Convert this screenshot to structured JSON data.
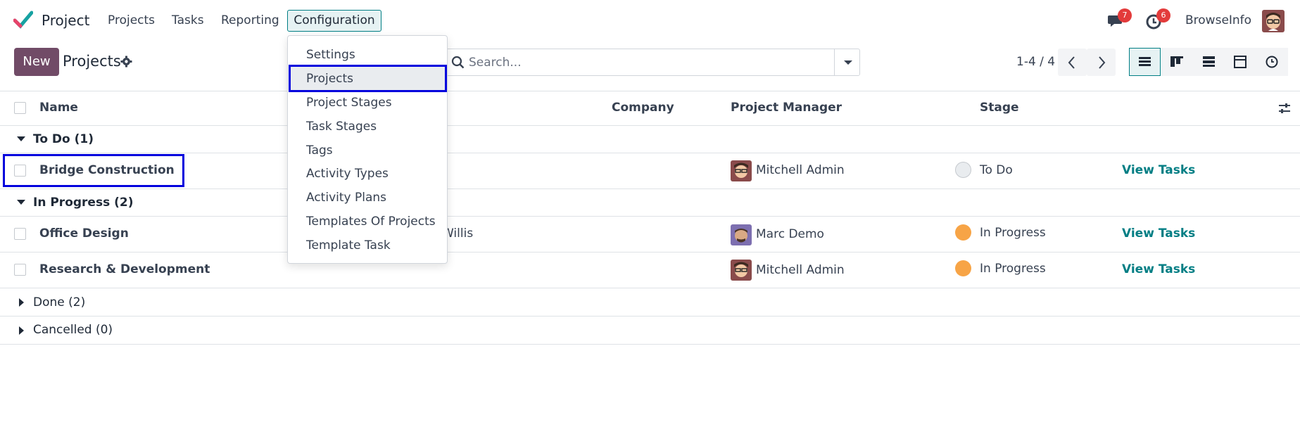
{
  "navbar": {
    "app_name": "Project",
    "menus": [
      "Projects",
      "Tasks",
      "Reporting",
      "Configuration"
    ],
    "messages_count": "7",
    "activities_count": "6",
    "company": "BrowseInfo"
  },
  "config_menu": {
    "items": [
      "Settings",
      "Projects",
      "Project Stages",
      "Task Stages",
      "Tags",
      "Activity Types",
      "Activity Plans",
      "Templates Of Projects",
      "Template Task"
    ],
    "active": "Projects"
  },
  "control_panel": {
    "new_label": "New",
    "title": "Projects",
    "search_placeholder": "Search...",
    "pager": "1-4 / 4"
  },
  "list": {
    "columns": [
      "Name",
      "Company",
      "Project Manager",
      "Stage"
    ],
    "groups": [
      {
        "label": "To Do (1)",
        "expanded": true
      },
      {
        "label": "In Progress (2)",
        "expanded": true
      },
      {
        "label": "Done (2)",
        "expanded": false
      },
      {
        "label": "Cancelled (0)",
        "expanded": false
      }
    ],
    "rows": [
      {
        "name": "Bridge Construction",
        "company": "",
        "manager": "Mitchell Admin",
        "stage": "To Do",
        "stage_color": "#e9ecef",
        "action": "View Tasks"
      },
      {
        "name": "Office Design",
        "company": "Willis",
        "manager": "Marc Demo",
        "stage": "In Progress",
        "stage_color": "#f7a446",
        "action": "View Tasks"
      },
      {
        "name": "Research & Development",
        "company": "",
        "manager": "Mitchell Admin",
        "stage": "In Progress",
        "stage_color": "#f7a446",
        "action": "View Tasks"
      }
    ]
  },
  "colors": {
    "accent": "#017e84",
    "primary_button": "#714b67",
    "highlight": "#0000dd"
  }
}
